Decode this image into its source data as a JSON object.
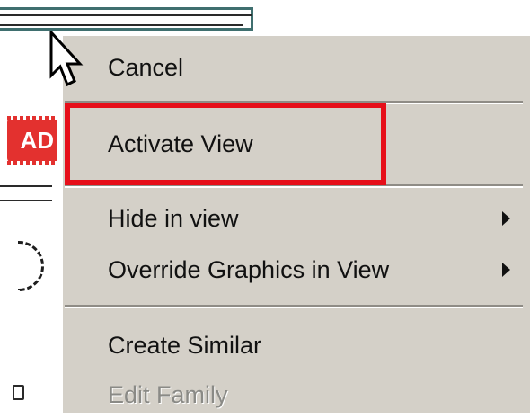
{
  "context_menu": {
    "items": [
      {
        "label": "Cancel",
        "enabled": true,
        "submenu": false
      },
      {
        "label": "Activate View",
        "enabled": true,
        "submenu": false,
        "highlighted": true
      },
      {
        "label": "Hide in view",
        "enabled": true,
        "submenu": true
      },
      {
        "label": "Override Graphics in View",
        "enabled": true,
        "submenu": true
      },
      {
        "label": "Create Similar",
        "enabled": true,
        "submenu": false
      },
      {
        "label": "Edit Family",
        "enabled": false,
        "submenu": false
      }
    ]
  },
  "canvas": {
    "tag_text": "AD"
  },
  "colors": {
    "menu_bg": "#d4d0c8",
    "highlight_border": "#e60f1a",
    "tag_red": "#e3312f",
    "frame_teal": "#3f6f6f"
  }
}
